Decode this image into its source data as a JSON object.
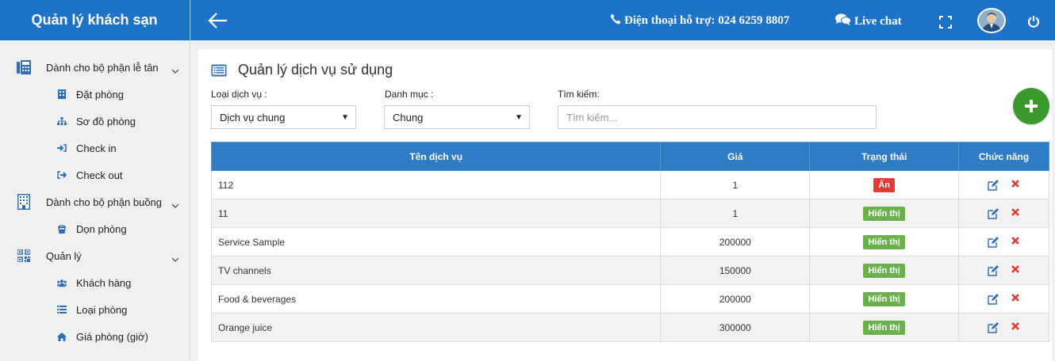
{
  "app": {
    "title": "Quản lý khách sạn"
  },
  "colors": {
    "primary": "#1e73c9",
    "table_header": "#2f7bc4",
    "add_button": "#3a9a2b",
    "badge_hidden": "#e53935",
    "badge_shown": "#6ab04c"
  },
  "sidebar": {
    "groups": [
      {
        "label": "Dành cho bộ phận lễ tân",
        "icon": "phone-desk-icon",
        "items": [
          {
            "label": "Đặt phòng",
            "icon": "building-icon"
          },
          {
            "label": "Sơ đồ phòng",
            "icon": "sitemap-icon"
          },
          {
            "label": "Check in",
            "icon": "sign-in-icon"
          },
          {
            "label": "Check out",
            "icon": "sign-out-icon"
          }
        ]
      },
      {
        "label": "Dành cho bộ phận buồng",
        "icon": "building-icon",
        "items": [
          {
            "label": "Dọn phòng",
            "icon": "bucket-icon"
          }
        ]
      },
      {
        "label": "Quản lý",
        "icon": "qrcode-icon",
        "items": [
          {
            "label": "Khách hàng",
            "icon": "users-icon"
          },
          {
            "label": "Loại phòng",
            "icon": "list-icon"
          },
          {
            "label": "Giá phòng (giờ)",
            "icon": "home-icon"
          }
        ]
      }
    ]
  },
  "header": {
    "hotline": "Điện thoại hỗ trợ: 024 6259 8807",
    "livechat": "Live chat"
  },
  "page": {
    "title": "Quản lý dịch vụ sử dụng",
    "filters": {
      "service_type_label": "Loại dịch vụ :",
      "service_type_value": "Dịch vụ chung",
      "category_label": "Danh mục :",
      "category_value": "Chung",
      "search_label": "Tìm kiếm:",
      "search_placeholder": "Tìm kiếm..."
    },
    "table": {
      "columns": [
        "Tên dịch vụ",
        "Giá",
        "Trạng thái",
        "Chức năng"
      ],
      "rows": [
        {
          "name": "112",
          "price": "1",
          "status": "Ẩn",
          "status_type": "hidden"
        },
        {
          "name": "11",
          "price": "1",
          "status": "Hiển thị",
          "status_type": "shown"
        },
        {
          "name": "Service Sample",
          "price": "200000",
          "status": "Hiển thị",
          "status_type": "shown"
        },
        {
          "name": "TV channels",
          "price": "150000",
          "status": "Hiển thị",
          "status_type": "shown"
        },
        {
          "name": "Food & beverages",
          "price": "200000",
          "status": "Hiển thị",
          "status_type": "shown"
        },
        {
          "name": "Orange juice",
          "price": "300000",
          "status": "Hiển thị",
          "status_type": "shown"
        }
      ]
    }
  }
}
